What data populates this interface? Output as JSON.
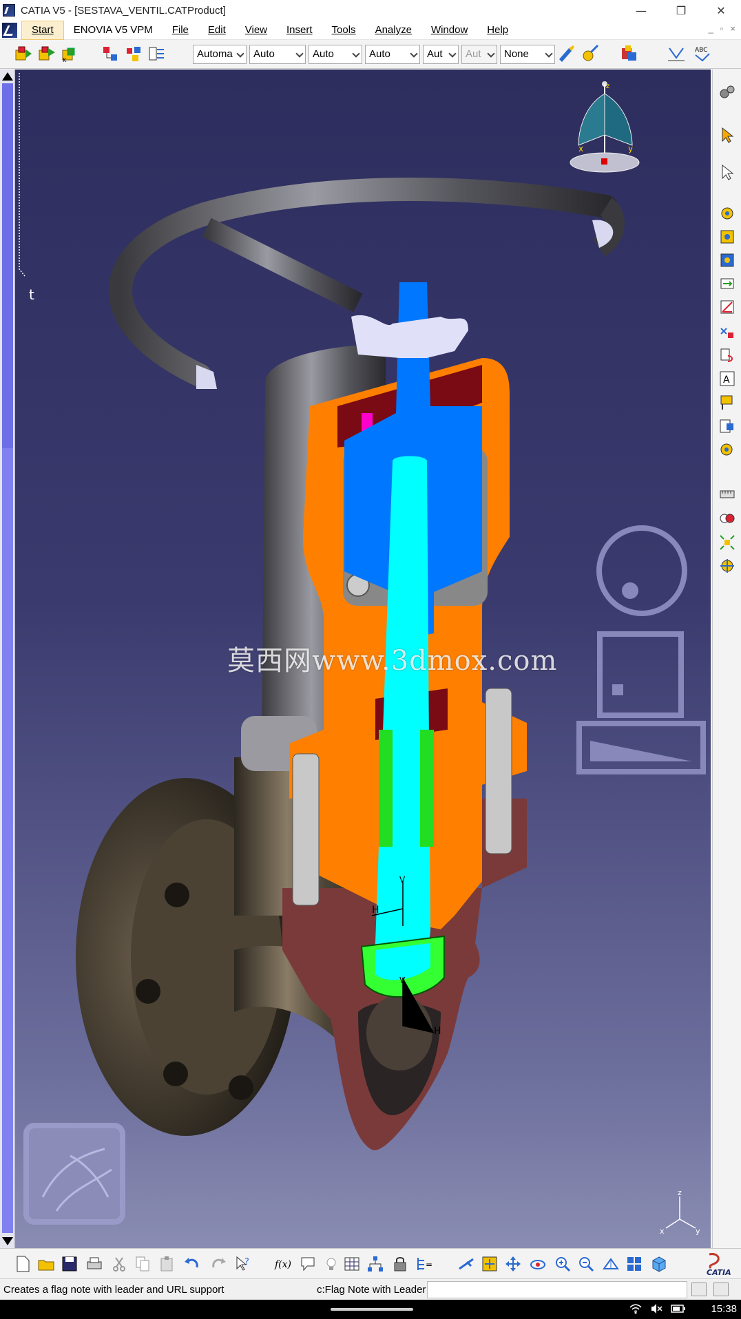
{
  "window": {
    "title": "CATIA V5 - [SESTAVA_VENTIL.CATProduct]",
    "minimize_glyph": "—",
    "maximize_glyph": "❐",
    "close_glyph": "✕"
  },
  "menu": {
    "items": [
      {
        "label": "Start"
      },
      {
        "label": "ENOVIA V5 VPM"
      },
      {
        "label": "File"
      },
      {
        "label": "Edit"
      },
      {
        "label": "View"
      },
      {
        "label": "Insert"
      },
      {
        "label": "Tools"
      },
      {
        "label": "Analyze"
      },
      {
        "label": "Window"
      },
      {
        "label": "Help"
      }
    ],
    "doc_min_glyph": "_",
    "doc_restore_glyph": "▫",
    "doc_close_glyph": "×"
  },
  "toolbar_top": {
    "combos": [
      {
        "value": "Automa"
      },
      {
        "value": "Auto"
      },
      {
        "value": "Auto"
      },
      {
        "value": "Auto"
      },
      {
        "value": "Aut"
      },
      {
        "value": "Aut"
      },
      {
        "value": "None"
      }
    ],
    "abc_label": "ABC"
  },
  "compass": {
    "axis_x": "x",
    "axis_y": "y",
    "axis_z": "z"
  },
  "triad": {
    "axis_x": "x",
    "axis_y": "y",
    "axis_z": "z"
  },
  "model_axes": {
    "label_h1": "H",
    "label_h2": "H",
    "label_v1": "V",
    "label_v2": "V"
  },
  "watermark": {
    "text": "莫西网www.3dmox.com"
  },
  "tree": {
    "marker": "t"
  },
  "status": {
    "message": "Creates a flag note with leader and URL support",
    "command_label": "c:Flag Note with Leader",
    "command_value": ""
  },
  "toolbar_bottom": {
    "fx_label": "f(x)"
  },
  "catia_logo": {
    "text": "CATIA"
  },
  "taskbar": {
    "clock": "15:38"
  },
  "colors": {
    "housing": "#ff8000",
    "stem_blue": "#0077ff",
    "stem_cyan": "#00ffff",
    "seal_green": "#33ff33",
    "body_red": "#7a3a3a",
    "packing_dark": "#7a0a14",
    "packing_magenta": "#ff00cc",
    "bolt_gray": "#c8c8c8",
    "background_top": "#2d2d5e",
    "background_bottom": "#8a8db2"
  }
}
